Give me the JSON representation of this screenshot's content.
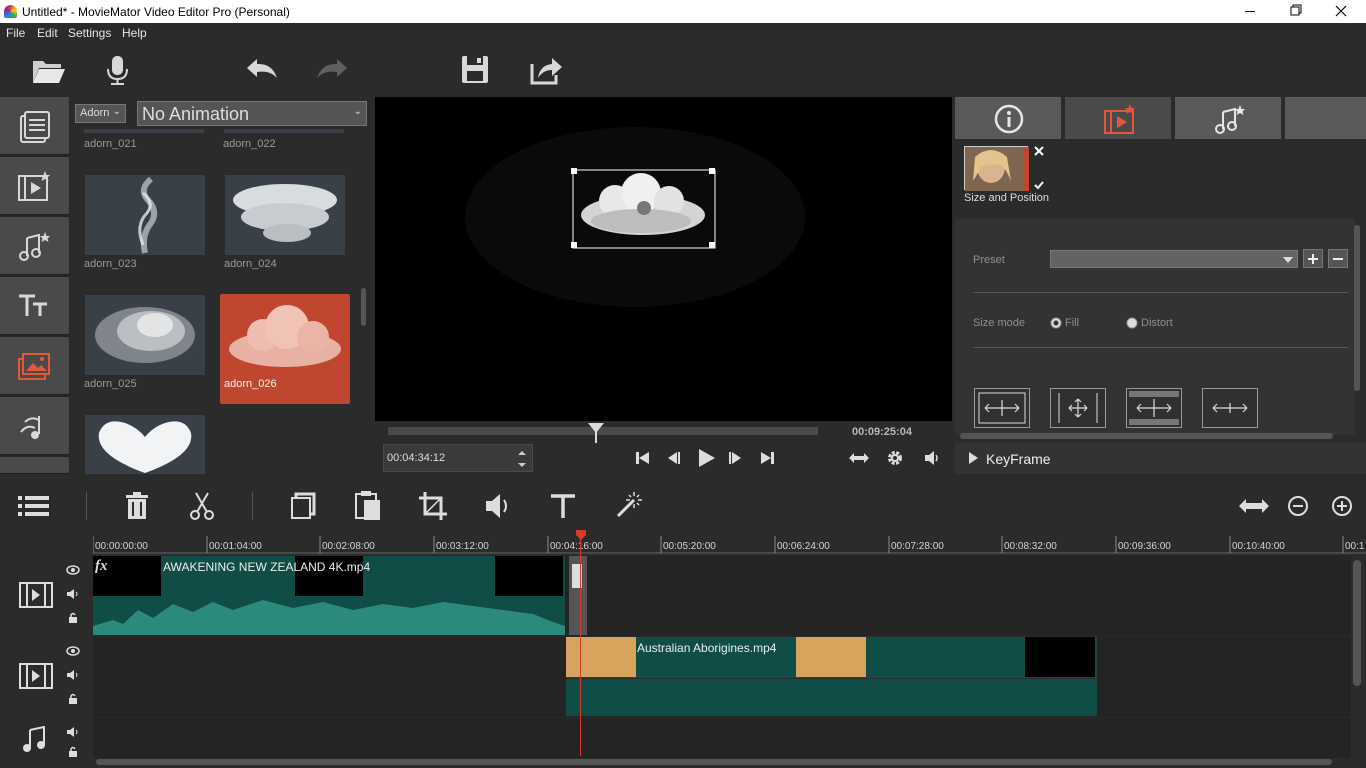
{
  "window": {
    "title": "Untitled* - MovieMator Video Editor Pro (Personal)"
  },
  "menu": [
    "File",
    "Edit",
    "Settings",
    "Help"
  ],
  "toolbar_icons": [
    "open-folder-icon",
    "microphone-icon",
    "undo-icon",
    "redo-icon",
    "save-icon",
    "export-icon"
  ],
  "library": {
    "category": "Adorn",
    "animation": "No Animation",
    "items": [
      {
        "label": "adorn_021"
      },
      {
        "label": "adorn_022"
      },
      {
        "label": "adorn_023"
      },
      {
        "label": "adorn_024"
      },
      {
        "label": "adorn_025"
      },
      {
        "label": "adorn_026",
        "selected": true
      }
    ]
  },
  "player": {
    "current_time": "00:04:34:12",
    "total_time": "00:09:25:04",
    "playhead_fraction": 0.48
  },
  "properties": {
    "filter_label": "Size and Position",
    "preset_label": "Preset",
    "preset_value": "",
    "size_mode_label": "Size mode",
    "size_mode_options": [
      "Fill",
      "Distort"
    ],
    "size_mode_selected": "Fill",
    "keyframe_label": "KeyFrame"
  },
  "timeline": {
    "ruler_ticks": [
      "00:00:00:00",
      "00:01:04:00",
      "00:02:08:00",
      "00:03:12:00",
      "00:04:16:00",
      "00:05:20:00",
      "00:06:24:00",
      "00:07:28:00",
      "00:08:32:00",
      "00:09:36:00",
      "00:10:40:00",
      "00:1"
    ],
    "clips": [
      {
        "track": "video-1",
        "name": "AWAKENING   NEW ZEALAND 4K.mp4"
      },
      {
        "track": "video-2",
        "name": "Australian Aborigines.mp4"
      }
    ],
    "fx_label": "fx"
  },
  "colors": {
    "accent": "#c0472f",
    "clip_teal": "#0f4d46",
    "playhead": "#d93a2b"
  }
}
